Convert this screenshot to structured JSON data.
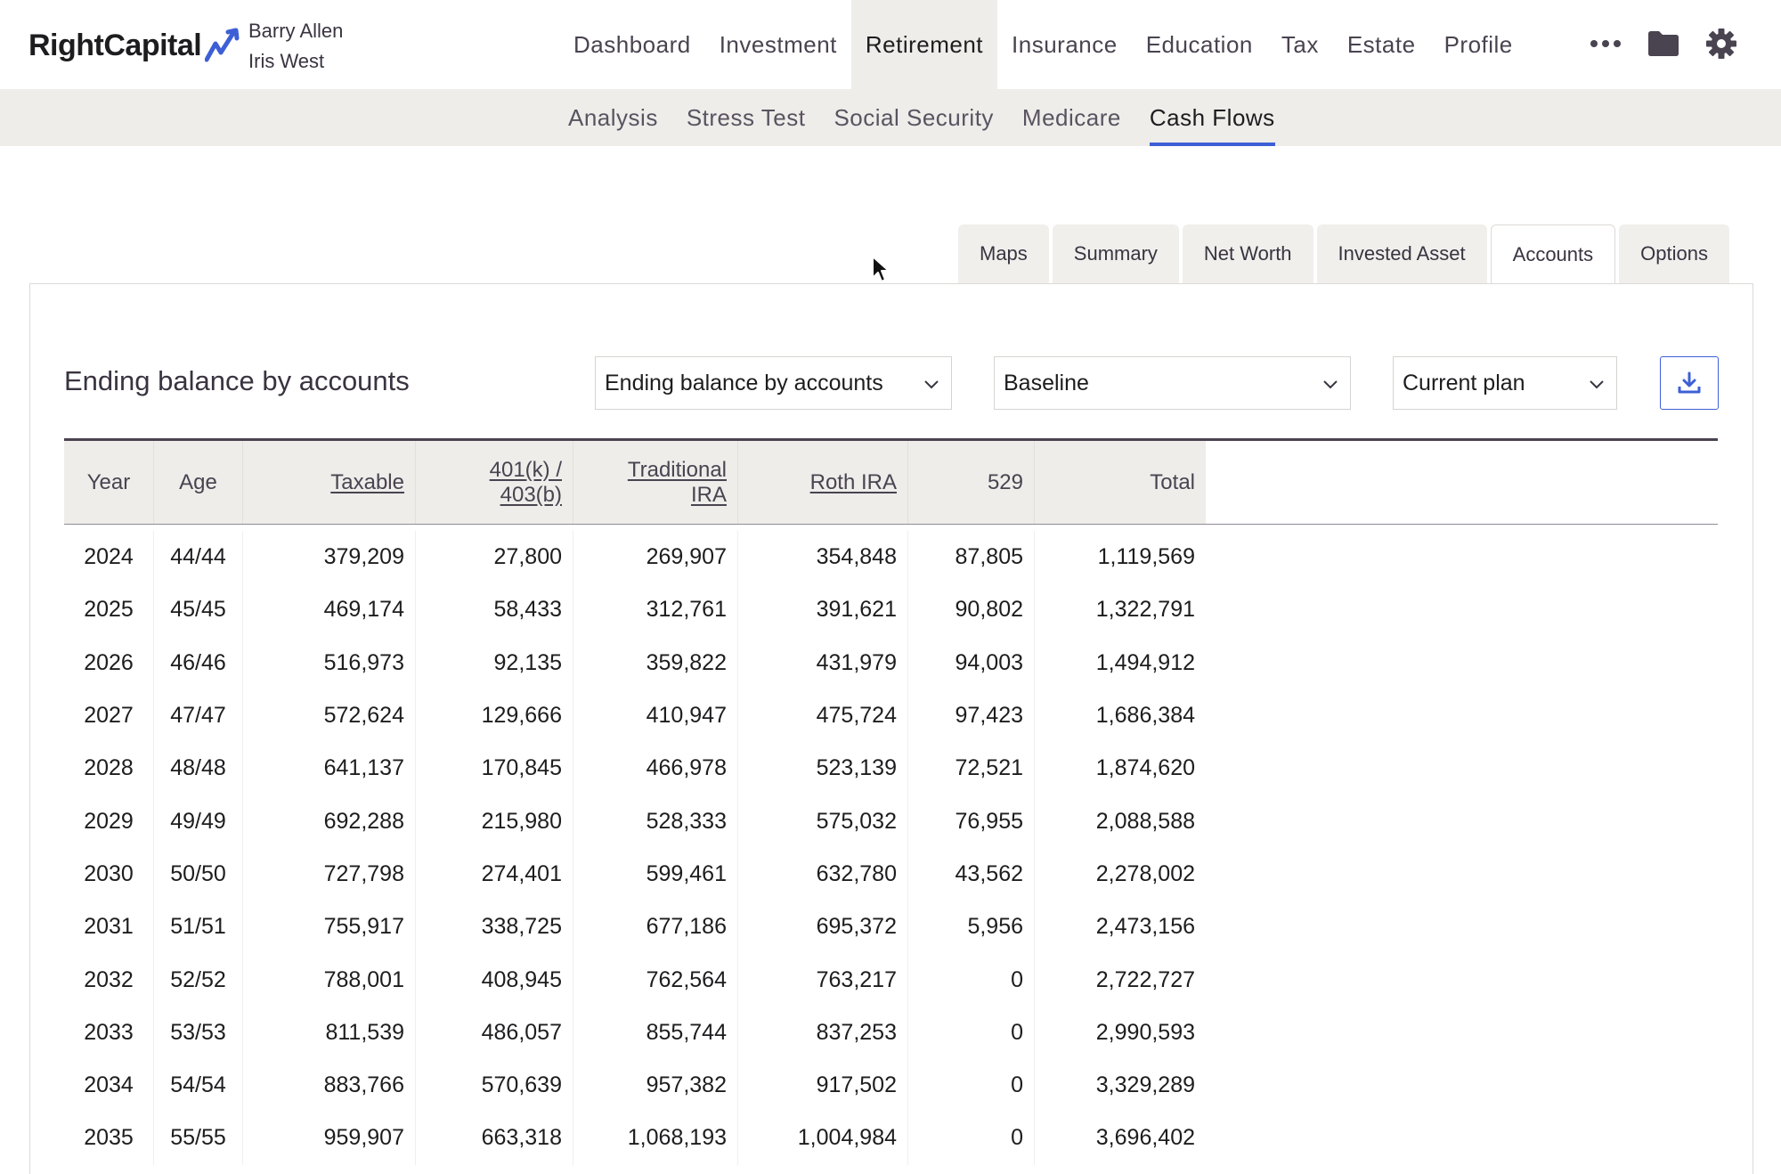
{
  "brand": {
    "name": "RightCapital"
  },
  "clients": [
    "Barry Allen",
    "Iris West"
  ],
  "main_nav": [
    {
      "label": "Dashboard",
      "active": false
    },
    {
      "label": "Investment",
      "active": false
    },
    {
      "label": "Retirement",
      "active": true
    },
    {
      "label": "Insurance",
      "active": false
    },
    {
      "label": "Education",
      "active": false
    },
    {
      "label": "Tax",
      "active": false
    },
    {
      "label": "Estate",
      "active": false
    },
    {
      "label": "Profile",
      "active": false
    }
  ],
  "nav_icons": [
    "more-icon",
    "folder-icon",
    "gear-icon"
  ],
  "sub_nav": [
    {
      "label": "Analysis",
      "active": false
    },
    {
      "label": "Stress Test",
      "active": false
    },
    {
      "label": "Social Security",
      "active": false
    },
    {
      "label": "Medicare",
      "active": false
    },
    {
      "label": "Cash Flows",
      "active": true
    }
  ],
  "tabs": [
    {
      "label": "Maps",
      "active": false
    },
    {
      "label": "Summary",
      "active": false
    },
    {
      "label": "Net Worth",
      "active": false
    },
    {
      "label": "Invested Asset",
      "active": false
    },
    {
      "label": "Accounts",
      "active": true
    },
    {
      "label": "Options",
      "active": false
    }
  ],
  "panel": {
    "title": "Ending balance by accounts",
    "view_select": "Ending balance by accounts",
    "scenario_select": "Baseline",
    "plan_select": "Current plan"
  },
  "table": {
    "columns": [
      {
        "label": "Year",
        "link": false
      },
      {
        "label": "Age",
        "link": false
      },
      {
        "label": "Taxable",
        "link": true
      },
      {
        "label": "401(k) / 403(b)",
        "link": true
      },
      {
        "label": "Traditional IRA",
        "link": true
      },
      {
        "label": "Roth IRA",
        "link": true
      },
      {
        "label": "529",
        "link": false
      },
      {
        "label": "Total",
        "link": false
      }
    ],
    "rows": [
      [
        "2024",
        "44/44",
        "379,209",
        "27,800",
        "269,907",
        "354,848",
        "87,805",
        "1,119,569"
      ],
      [
        "2025",
        "45/45",
        "469,174",
        "58,433",
        "312,761",
        "391,621",
        "90,802",
        "1,322,791"
      ],
      [
        "2026",
        "46/46",
        "516,973",
        "92,135",
        "359,822",
        "431,979",
        "94,003",
        "1,494,912"
      ],
      [
        "2027",
        "47/47",
        "572,624",
        "129,666",
        "410,947",
        "475,724",
        "97,423",
        "1,686,384"
      ],
      [
        "2028",
        "48/48",
        "641,137",
        "170,845",
        "466,978",
        "523,139",
        "72,521",
        "1,874,620"
      ],
      [
        "2029",
        "49/49",
        "692,288",
        "215,980",
        "528,333",
        "575,032",
        "76,955",
        "2,088,588"
      ],
      [
        "2030",
        "50/50",
        "727,798",
        "274,401",
        "599,461",
        "632,780",
        "43,562",
        "2,278,002"
      ],
      [
        "2031",
        "51/51",
        "755,917",
        "338,725",
        "677,186",
        "695,372",
        "5,956",
        "2,473,156"
      ],
      [
        "2032",
        "52/52",
        "788,001",
        "408,945",
        "762,564",
        "763,217",
        "0",
        "2,722,727"
      ],
      [
        "2033",
        "53/53",
        "811,539",
        "486,057",
        "855,744",
        "837,253",
        "0",
        "2,990,593"
      ],
      [
        "2034",
        "54/54",
        "883,766",
        "570,639",
        "957,382",
        "917,502",
        "0",
        "3,329,289"
      ],
      [
        "2035",
        "55/55",
        "959,907",
        "663,318",
        "1,068,193",
        "1,004,984",
        "0",
        "3,696,402"
      ]
    ]
  },
  "colors": {
    "accent": "#3d5fd6",
    "nav_bg": "#eeedea",
    "text": "#3a3340"
  }
}
